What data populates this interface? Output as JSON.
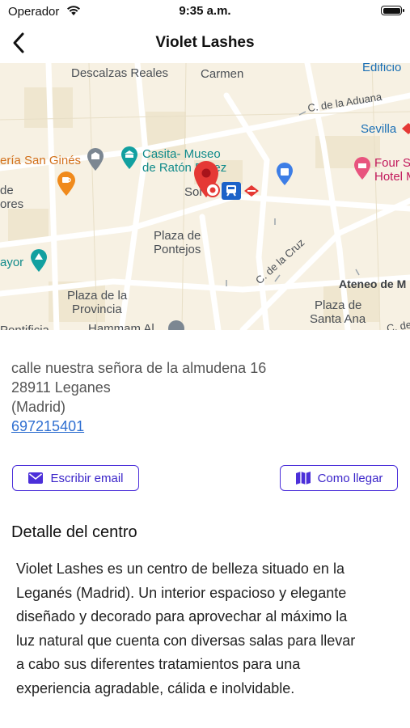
{
  "status_bar": {
    "carrier": "Operador",
    "time": "9:35 a.m."
  },
  "nav": {
    "title": "Violet Lashes"
  },
  "map": {
    "labels": [
      {
        "text": "Edificio",
        "color": "blue"
      },
      {
        "text": "Descalzas Reales",
        "color": "gray"
      },
      {
        "text": "Carmen",
        "color": "gray"
      },
      {
        "text": "C. de la Aduana",
        "color": "gray"
      },
      {
        "text": "Sevilla",
        "color": "blue"
      },
      {
        "text": "ería San Ginés",
        "color": "orange"
      },
      {
        "text": "Casita- Museo",
        "color": "teal"
      },
      {
        "text": "de Ratón Pérez",
        "color": "teal"
      },
      {
        "text": "Four S",
        "color": "pink"
      },
      {
        "text": "Hotel M",
        "color": "pink"
      },
      {
        "text": "de",
        "color": "gray"
      },
      {
        "text": "ores",
        "color": "gray"
      },
      {
        "text": "Sol",
        "color": "gray"
      },
      {
        "text": "Plaza de",
        "color": "gray"
      },
      {
        "text": "Pontejos",
        "color": "gray"
      },
      {
        "text": "ayor",
        "color": "teal"
      },
      {
        "text": "C. de la Cruz",
        "color": "gray"
      },
      {
        "text": "Ateneo de M",
        "color": "dark"
      },
      {
        "text": "Plaza de la",
        "color": "gray"
      },
      {
        "text": "Provincia",
        "color": "gray"
      },
      {
        "text": "Plaza de",
        "color": "gray"
      },
      {
        "text": "Santa Ana",
        "color": "gray"
      },
      {
        "text": "Hammam Al",
        "color": "gray"
      },
      {
        "text": "Pontificia",
        "color": "gray"
      },
      {
        "text": "C. de",
        "color": "gray"
      }
    ]
  },
  "address": {
    "line1": "calle nuestra señora de la almudena 16",
    "line2": "28911 Leganes",
    "line3": "(Madrid)",
    "phone": "697215401"
  },
  "actions": {
    "email_label": "Escribir email",
    "route_label": "Como llegar"
  },
  "details": {
    "title": "Detalle del centro",
    "lines": [
      "Violet Lashes es un centro de belleza situado en la",
      "Leganés (Madrid). Un interior espacioso y elegante",
      "diseñado y decorado para aprovechar al máximo la",
      "luz natural que cuenta con diversas salas para llevar",
      "a cabo sus diferentes tratamientos para una",
      "experiencia agradable, cálida e inolvidable."
    ]
  },
  "colors": {
    "accent": "#4b2fd9",
    "link": "#2f6fd1",
    "map_bg": "#f7f1e3",
    "pin": "#e53935"
  }
}
